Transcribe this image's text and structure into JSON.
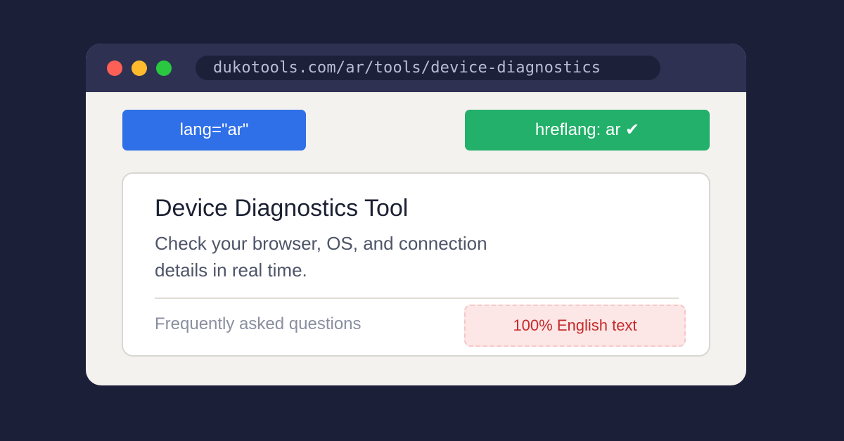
{
  "colors": {
    "page_background": "#1b1f38",
    "title_bar": "#2e3152",
    "window_background": "#f4f2ef",
    "close_dot": "#fe5f57",
    "minimize_dot": "#febb2e",
    "maximize_dot": "#29c840",
    "lang_badge": "#2f6fe8",
    "hreflang_badge": "#22b06a",
    "warning_background": "#fde6e6",
    "warning_text": "#c52a2a"
  },
  "browser": {
    "url": "dukotools.com/ar/tools/device-diagnostics"
  },
  "badges": {
    "lang_label": "lang=\"ar\"",
    "hreflang_label": "hreflang: ar ✔"
  },
  "card": {
    "title": "Device Diagnostics Tool",
    "description": "Check your browser, OS, and connection details in real time.",
    "faq_label": "Frequently asked questions",
    "warning_label": "100% English text"
  }
}
